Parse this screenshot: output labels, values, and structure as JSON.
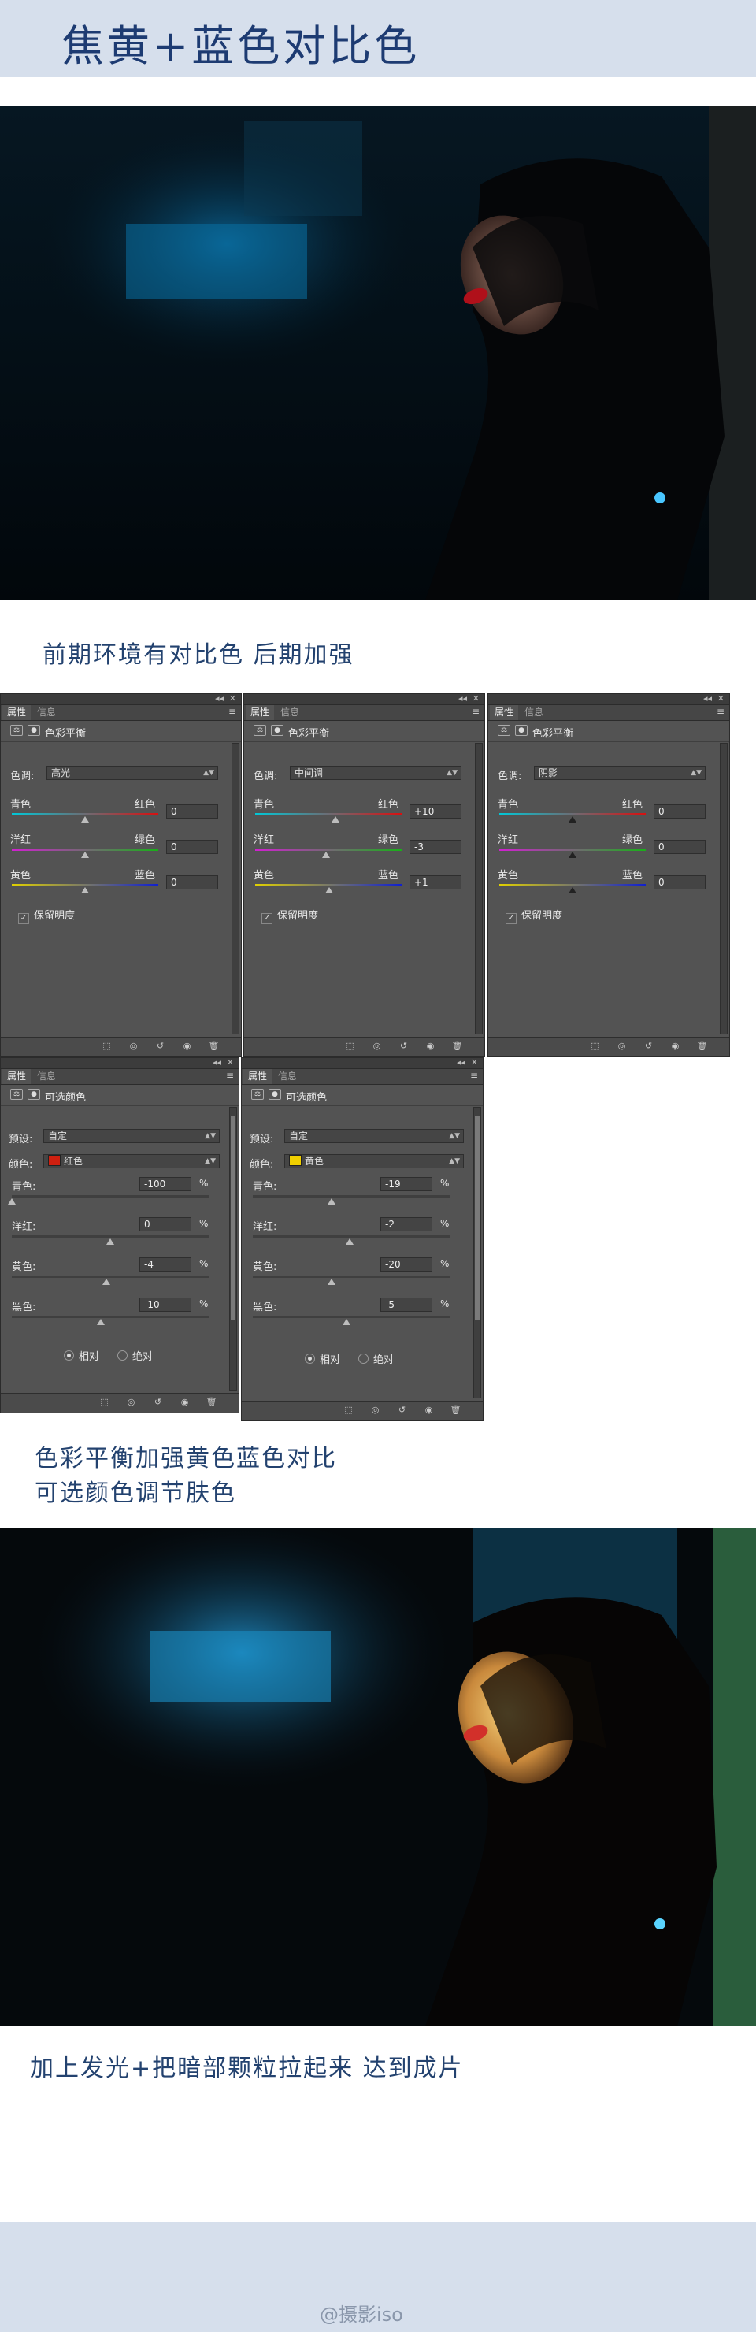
{
  "title": "焦黄+蓝色对比色",
  "captions": {
    "c1": "前期环境有对比色 后期加强",
    "c2_line1": "色彩平衡加强黄色蓝色对比",
    "c2_line2": "可选颜色调节肤色",
    "c3": "加上发光+把暗部颗粒拉起来 达到成片"
  },
  "watermark": "@摄影iso",
  "colors": {
    "band": "#d6dfec",
    "title": "#1d3b72",
    "panel": "#535353"
  },
  "panel_common": {
    "tab_properties": "属性",
    "tab_info": "信息",
    "tone_label": "色调:",
    "cyan": "青色",
    "red": "红色",
    "magenta": "洋红",
    "green": "绿色",
    "yellow": "黄色",
    "blue": "蓝色",
    "preserve": "保留明度",
    "collapse": "◂◂",
    "close": "✕",
    "menu": "≡"
  },
  "color_balance": {
    "label": "色彩平衡",
    "panels": [
      {
        "tone": "高光",
        "cyan_red": "0",
        "magenta_green": "0",
        "yellow_blue": "0",
        "slider_levels": [
          0.5,
          0.5,
          0.5
        ]
      },
      {
        "tone": "中间调",
        "cyan_red": "+10",
        "magenta_green": "-3",
        "yellow_blue": "+1",
        "slider_levels": [
          0.55,
          0.485,
          0.505
        ]
      },
      {
        "tone": "阴影",
        "cyan_red": "0",
        "magenta_green": "0",
        "yellow_blue": "0",
        "slider_levels": [
          0.5,
          0.5,
          0.5
        ]
      }
    ]
  },
  "selective_color": {
    "label": "可选颜色",
    "preset_label": "预设:",
    "preset_value": "自定",
    "colors_label": "颜色:",
    "cyan_label": "青色:",
    "magenta_label": "洋红:",
    "yellow_label": "黄色:",
    "black_label": "黑色:",
    "pct": "%",
    "relative": "相对",
    "absolute": "绝对",
    "panels": [
      {
        "color_name": "红色",
        "swatch": "#d02010",
        "cyan": "-100",
        "magenta": "0",
        "yellow": "-4",
        "black": "-10",
        "slider_levels": [
          0.0,
          0.5,
          0.48,
          0.45
        ]
      },
      {
        "color_name": "黄色",
        "swatch": "#f0d000",
        "cyan": "-19",
        "magenta": "-2",
        "yellow": "-20",
        "black": "-5",
        "slider_levels": [
          0.4,
          0.49,
          0.4,
          0.475
        ]
      }
    ]
  }
}
